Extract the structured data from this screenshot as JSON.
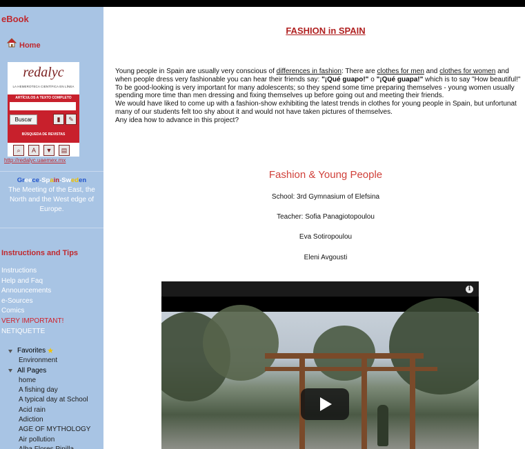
{
  "sidebar": {
    "title": "eBook",
    "home_label": "Home",
    "redalyc": {
      "logo": "redalyc",
      "subtitle": "LA HEMEROTECA CIENTÍFICA EN LÍNEA",
      "articles_label": "ARTÍCULOS A TEXTO COMPLETO",
      "search_button": "Buscar",
      "journals_label": "BÚSQUEDA DE REVISTAS",
      "link": "http://redalyc.uaemex.mx"
    },
    "gss": {
      "parts": [
        {
          "text": "Gr",
          "color": "#2255cc"
        },
        {
          "text": "ee",
          "color": "#ffffff"
        },
        {
          "text": "ce",
          "color": "#2255cc"
        },
        {
          "text": "-Sp",
          "color": "#ffffff"
        },
        {
          "text": "a",
          "color": "#f2c200"
        },
        {
          "text": "in",
          "color": "#c0282d"
        },
        {
          "text": "-Sw",
          "color": "#ffffff"
        },
        {
          "text": "ed",
          "color": "#f2c200"
        },
        {
          "text": "en",
          "color": "#2255cc"
        }
      ]
    },
    "meeting": "The Meeting of the East, the North and the West edge of Europe.",
    "instructions_title": "Instructions and Tips",
    "nav": [
      {
        "label": "Instructions",
        "color": "#ffffff"
      },
      {
        "label": "Help and Faq",
        "color": "#ffffff"
      },
      {
        "label": "Announcements",
        "color": "#ffffff"
      },
      {
        "label": "e-Sources",
        "color": "#ffffff"
      },
      {
        "label": "Comics",
        "color": "#ffffff"
      },
      {
        "label": "VERY IMPORTANT!",
        "color": "#d0202a"
      },
      {
        "label": "NETIQUETTE",
        "color": "#ffffff"
      }
    ],
    "favorites_label": "Favorites",
    "favorites_items": [
      "Environment"
    ],
    "all_pages_label": "All Pages",
    "pages": [
      "home",
      "A fishing day",
      "A typical day at School",
      "Acid rain",
      "Adiction",
      "AGE OF MYTHOLOGY",
      "Air pollution",
      "Alba Flores Pinilla"
    ]
  },
  "main": {
    "title": "FASHION in SPAIN",
    "para": {
      "l1a": "Young people in Spain are usually very conscious of ",
      "l1_link1": "differences in fashion",
      "l1b": ": There are ",
      "l1_link2": "clothes for men",
      "l1c": " and ",
      "l1_link3": "clothes for women",
      "l1d": " and",
      "l2a": "when people dress very fashionable you can hear their friends say: ",
      "l2_b1": "\"¡Qué guapo!\"",
      "l2b": " o ",
      "l2_b2": "\"¡Qué guapa!\"",
      "l2c": " which is to say \"How beautiful!\"",
      "l3": "To be good-looking is very important for many adolescents; so they spend some time preparing themselves - young women usually",
      "l4": "spending more time than men dressing and fixing themselves up before going out and meeting their friends.",
      "l5": "We would have liked to come up with a fashion-show exhibiting the latest trends in clothes for young people in Spain, but unfortunat",
      "l6": "many of our students felt too shy about it and would not have taken pictures of themselves.",
      "l7": "Any idea how to advance in this project?"
    },
    "subtitle": "Fashion & Young People",
    "school": "School: 3rd Gymnasium of Elefsina",
    "teacher": "Teacher: Sofia Panagiotopoulou",
    "student1": "Eva Sotiropoulou",
    "student2": "Eleni Avgousti",
    "video": {
      "info_icon": "i"
    }
  }
}
